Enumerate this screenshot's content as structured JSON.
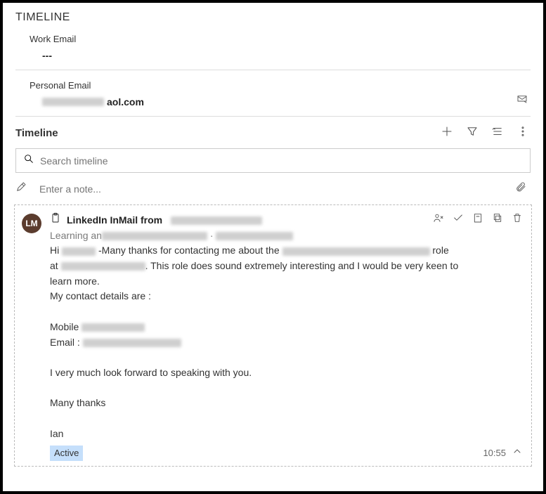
{
  "panel_title": "TIMELINE",
  "fields": {
    "work_email": {
      "label": "Work Email",
      "value": "---"
    },
    "personal_email": {
      "label": "Personal Email",
      "value_suffix": "aol.com"
    }
  },
  "section": {
    "title": "Timeline",
    "search_placeholder": "Search timeline",
    "note_placeholder": "Enter a note..."
  },
  "card": {
    "avatar_initials": "LM",
    "title_prefix": "LinkedIn InMail from",
    "subtitle_prefix": "Learning an",
    "msg_l1_a": "Hi ",
    "msg_l1_b": " -Many thanks for contacting me about the ",
    "msg_l1_c": " role",
    "msg_l2_a": "at ",
    "msg_l2_b": ". This role does sound extremely interesting and I would be very keen to",
    "msg_l3": "learn more.",
    "msg_l4": "My contact details are :",
    "msg_mobile_label": "Mobile ",
    "msg_email_label": " Email : ",
    "msg_l7": "I very much look forward to speaking with you.",
    "msg_l8": "Many thanks",
    "msg_l9": "Ian",
    "status": "Active",
    "time": "10:55"
  }
}
